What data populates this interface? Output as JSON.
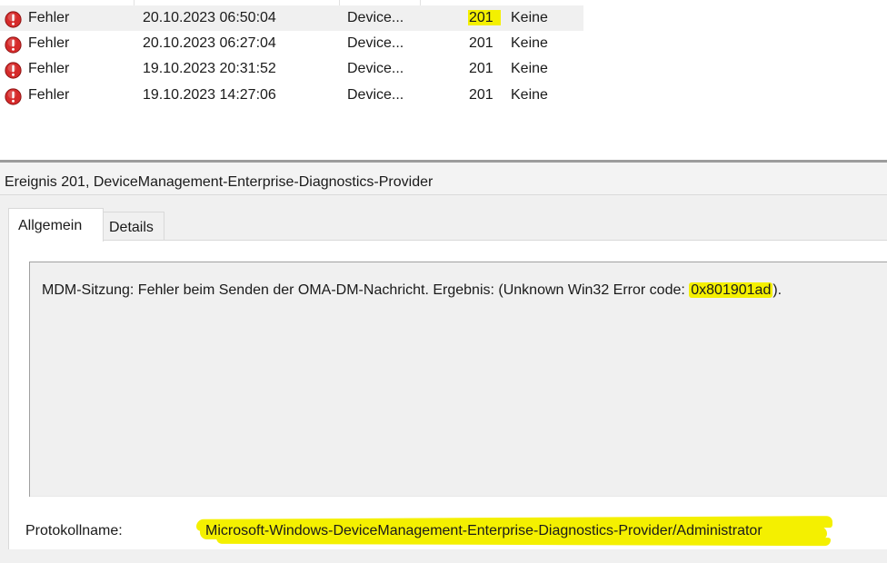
{
  "colors": {
    "highlight": "#f4f000",
    "error_icon": "#d62b2b",
    "selected_row": "#f0f0f0",
    "pane_background": "#f0f0f0"
  },
  "event_list": {
    "rows": [
      {
        "level": "Fehler",
        "icon": "error-icon",
        "datetime": "20.10.2023 06:50:04",
        "source": "Device...",
        "event_id": "201",
        "task_category": "Keine",
        "selected": true
      },
      {
        "level": "Fehler",
        "icon": "error-icon",
        "datetime": "20.10.2023 06:27:04",
        "source": "Device...",
        "event_id": "201",
        "task_category": "Keine"
      },
      {
        "level": "Fehler",
        "icon": "error-icon",
        "datetime": "19.10.2023 20:31:52",
        "source": "Device...",
        "event_id": "201",
        "task_category": "Keine"
      },
      {
        "level": "Fehler",
        "icon": "error-icon",
        "datetime": "19.10.2023 14:27:06",
        "source": "Device...",
        "event_id": "201",
        "task_category": "Keine"
      }
    ]
  },
  "detail": {
    "title": "Ereignis 201, DeviceManagement-Enterprise-Diagnostics-Provider",
    "tabs": [
      {
        "label": "Allgemein",
        "active": true
      },
      {
        "label": "Details",
        "active": false
      }
    ],
    "message": {
      "prefix": "MDM-Sitzung: Fehler beim Senden der OMA-DM-Nachricht. Ergebnis: (Unknown Win32 Error code: ",
      "error_code": "0x801901ad",
      "suffix": ")."
    },
    "log_name_label": "Protokollname:",
    "log_name_value": "Microsoft-Windows-DeviceManagement-Enterprise-Diagnostics-Provider/Administrator"
  }
}
